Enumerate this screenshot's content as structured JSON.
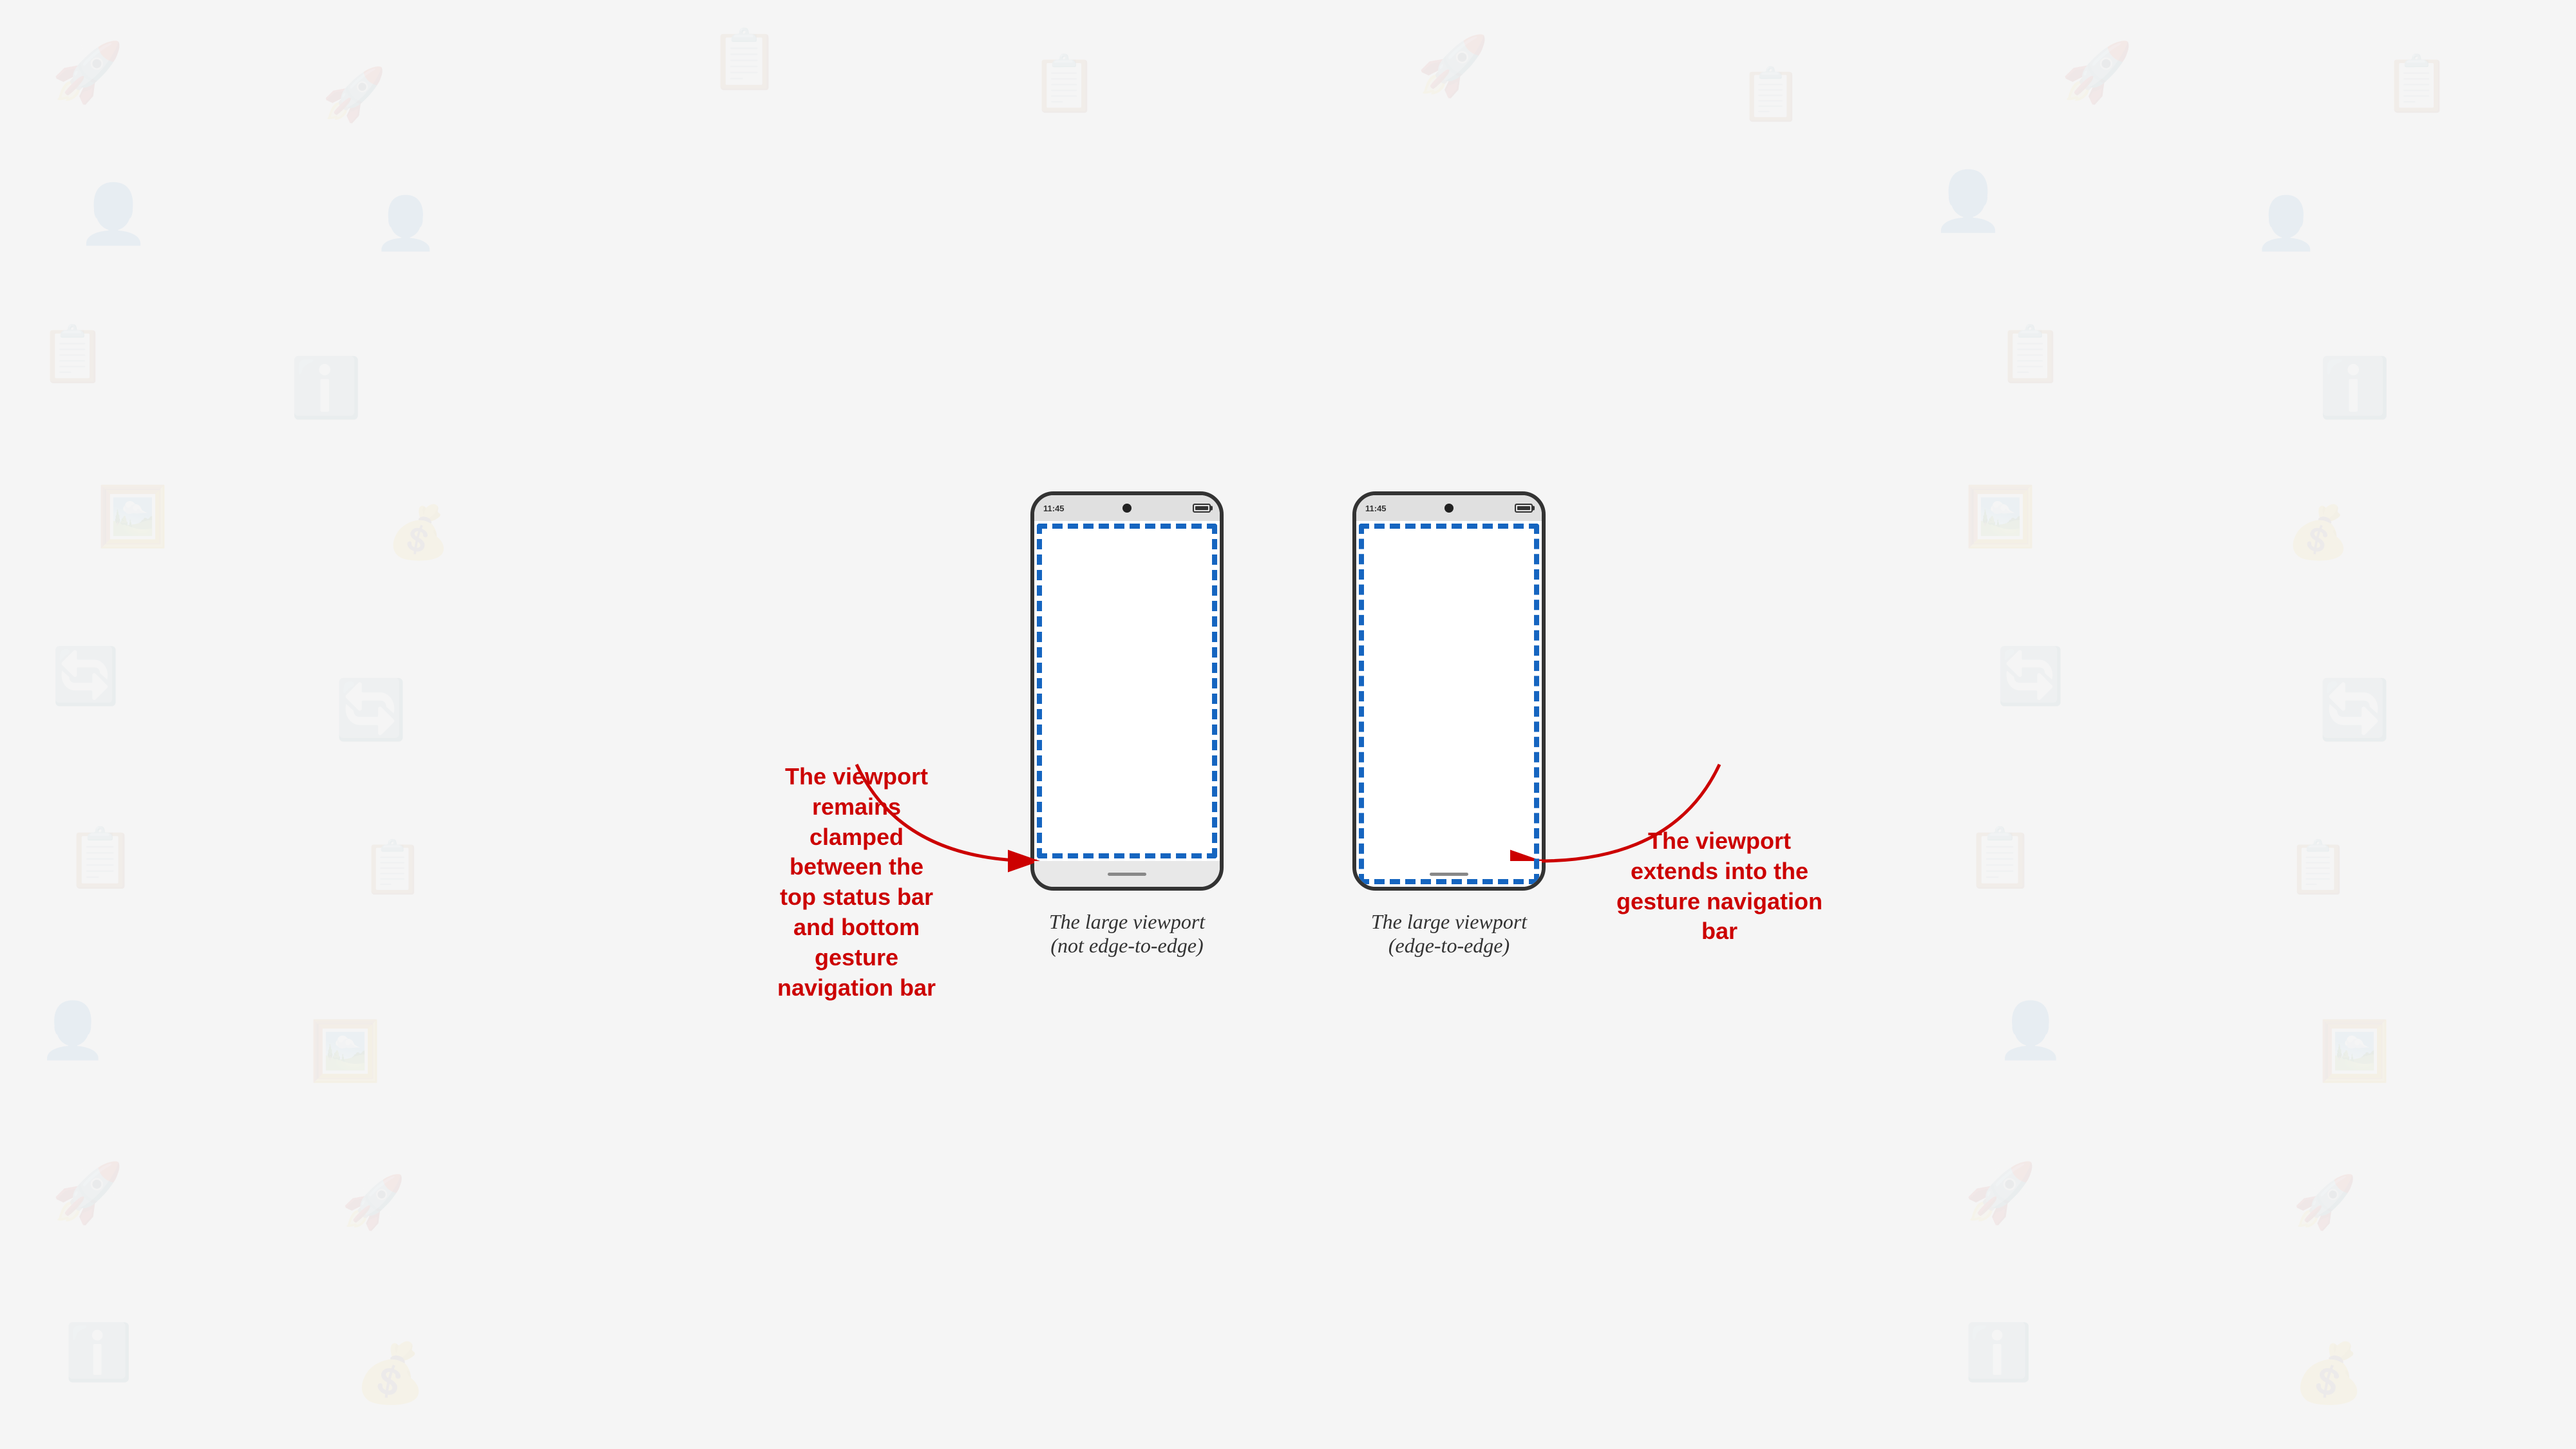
{
  "background": {
    "color": "#f0eeec"
  },
  "phones": [
    {
      "id": "not-edge",
      "status_time": "11:45",
      "label_line1": "The large viewport",
      "label_line2": "(not edge-to-edge)",
      "type": "not-edge"
    },
    {
      "id": "edge",
      "status_time": "11:45",
      "label_line1": "The large viewport",
      "label_line2": "(edge-to-edge)",
      "type": "edge"
    }
  ],
  "annotations": {
    "left": {
      "line1": "The viewport",
      "line2": "remains",
      "line3": "clamped",
      "line4": "between the",
      "line5": "top status bar",
      "line6": "and bottom",
      "line7": "gesture",
      "line8": "navigation bar"
    },
    "right": {
      "line1": "The viewport",
      "line2": "extends into the",
      "line3": "gesture navigation",
      "line4": "bar"
    }
  }
}
